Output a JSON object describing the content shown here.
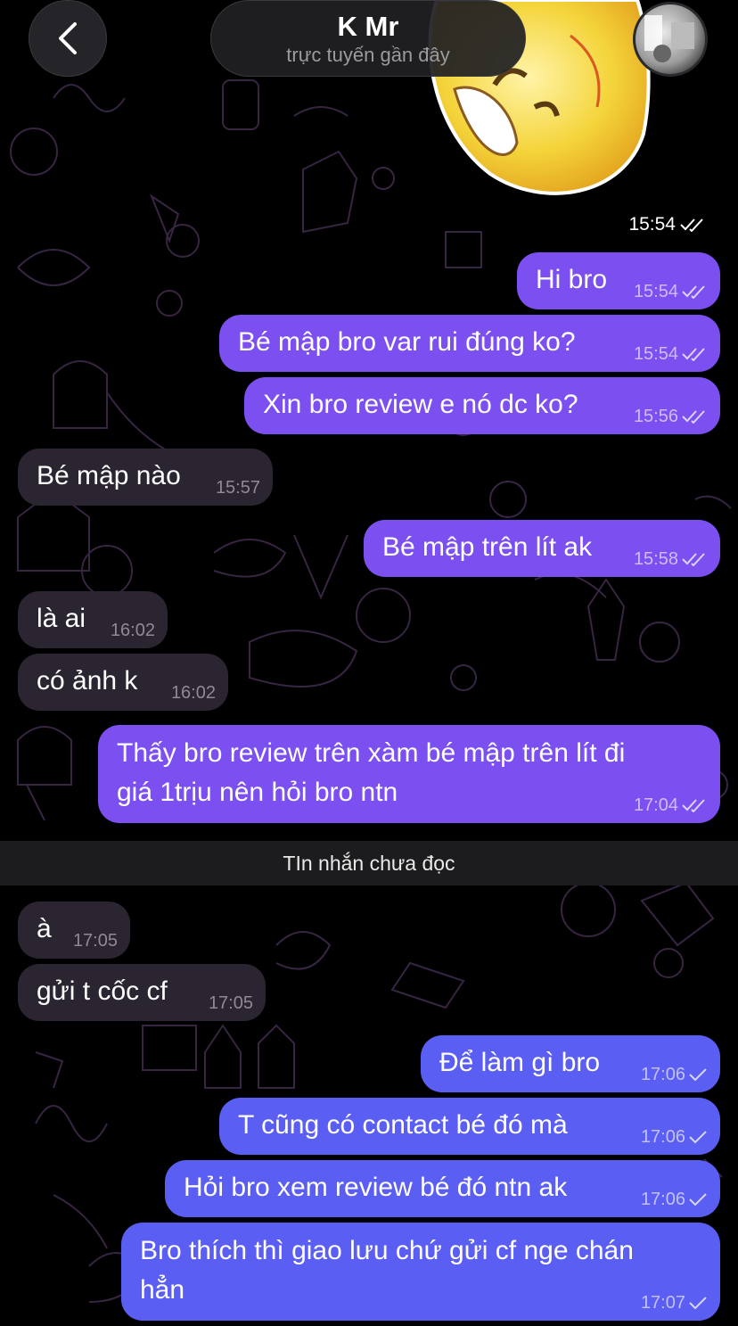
{
  "header": {
    "contact_name": "K Mr",
    "status": "trực tuyến gần đây"
  },
  "sticker": {
    "time": "15:54"
  },
  "messages": [
    {
      "text": "Hi bro",
      "time": "15:54"
    },
    {
      "text": "Bé mập bro var rui đúng ko?",
      "time": "15:54"
    },
    {
      "text": "Xin bro review e nó dc ko?",
      "time": "15:56"
    },
    {
      "text": "Bé mập nào",
      "time": "15:57"
    },
    {
      "text": "Bé mập trên lít ak",
      "time": "15:58"
    },
    {
      "text": "là ai",
      "time": "16:02"
    },
    {
      "text": "có ảnh k",
      "time": "16:02"
    },
    {
      "text_line1": "Thấy bro review trên xàm bé mập trên lít đi",
      "text_line2": "giá 1trịu nên hỏi bro ntn",
      "time": "17:04"
    },
    {
      "text": "à",
      "time": "17:05"
    },
    {
      "text": "gửi t cốc cf",
      "time": "17:05"
    },
    {
      "text": "Để làm gì bro",
      "time": "17:06"
    },
    {
      "text": "T cũng có contact bé đó mà",
      "time": "17:06"
    },
    {
      "text": "Hỏi bro xem review bé đó ntn ak",
      "time": "17:06"
    },
    {
      "text_line1": "Bro thích thì giao lưu chứ gửi cf nge chán",
      "text_line2": "hẳn",
      "time": "17:07"
    }
  ],
  "unread_divider": "TIn nhắn chưa đọc",
  "colors": {
    "outgoing_read": "#7b4ff0",
    "outgoing_sent": "#5b5ef2",
    "incoming": "#2a2530",
    "background": "#000000"
  },
  "icons": [
    "back-chevron-icon",
    "double-check-icon",
    "single-check-icon",
    "contact-avatar"
  ]
}
